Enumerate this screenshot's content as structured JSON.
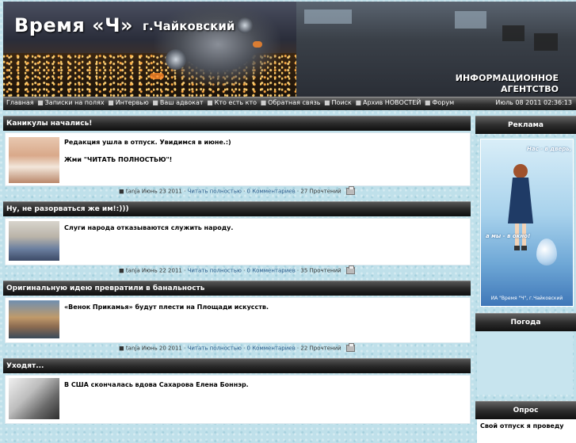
{
  "header": {
    "title": "Время «Ч»",
    "city": "г.Чайковский",
    "agency_line1": "ИНФОРМАЦИОННОЕ",
    "agency_line2": "АГЕНТСТВО"
  },
  "nav": {
    "items": [
      "Главная",
      "Записки на полях",
      "Интервью",
      "Ваш адвокат",
      "Кто есть кто",
      "Обратная связь",
      "Поиск",
      "Архив НОВОСТЕЙ",
      "Форум"
    ],
    "datetime": "Июль 08 2011 02:36:13"
  },
  "news": [
    {
      "title": "Каникулы начались!",
      "lines": [
        "Редакция ушла в отпуск. Увидимся в июне.:)",
        "",
        "Жми \"ЧИТАТЬ ПОЛНОСТЬЮ\"!"
      ],
      "author": "tanja",
      "date": "Июнь 23 2011",
      "read_more": "Читать полностью",
      "comments": "0 Комментариев",
      "reads": "27 Прочтений"
    },
    {
      "title": "Ну, не разорваться же им!:)))",
      "lines": [
        "Слуги народа отказываются служить народу."
      ],
      "author": "tanja",
      "date": "Июнь 22 2011",
      "read_more": "Читать полностью",
      "comments": "0 Комментариев",
      "reads": "35 Прочтений"
    },
    {
      "title": "Оригинальную идею превратили в банальность",
      "lines": [
        "«Венок Прикамья» будут плести на Площади искусств."
      ],
      "author": "tanja",
      "date": "Июнь 20 2011",
      "read_more": "Читать полностью",
      "comments": "0 Комментариев",
      "reads": "22 Прочтений"
    },
    {
      "title": "Уходят...",
      "lines": [
        "В США скончалась вдова Сахарова Елена Боннэр."
      ]
    }
  ],
  "sidebar": {
    "ads_title": "Реклама",
    "ad_text_top_1": "Нас - в дверь,",
    "ad_text_top_2": "а мы - в окно!",
    "ad_caption": "ИА \"Время \"Ч\", г.Чайковский",
    "weather_title": "Погода",
    "poll_title": "Опрос",
    "poll_question": "Свой отпуск я проведу"
  },
  "colors": {
    "page_bg": "#bfe0ea",
    "bar_dark": "#1a1a1a",
    "link": "#2a5a8a"
  }
}
